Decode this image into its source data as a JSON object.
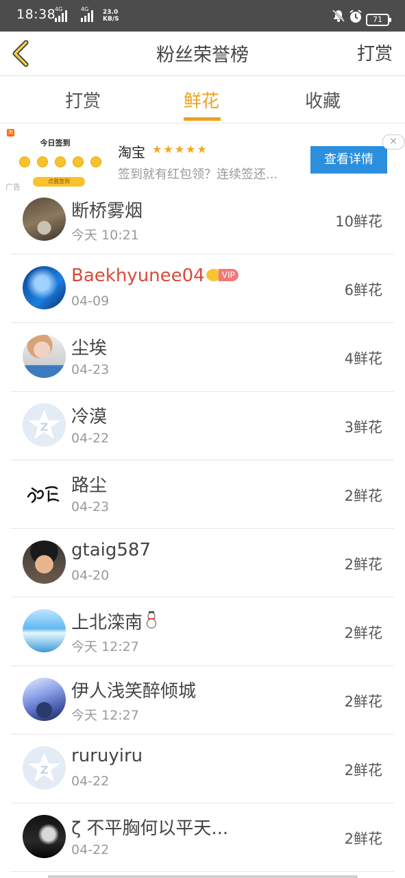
{
  "status_bar": {
    "time": "18:38",
    "signal_tag_1": "4G",
    "signal_tag_2": "4G",
    "net_speed_value": "23.0",
    "net_speed_unit": "KB/S",
    "battery": "71"
  },
  "nav": {
    "title": "粉丝荣誉榜",
    "action_label": "打赏"
  },
  "tabs": [
    {
      "label": "打赏",
      "active": false
    },
    {
      "label": "鲜花",
      "active": true
    },
    {
      "label": "收藏",
      "active": false
    }
  ],
  "ad": {
    "thumb_badge": "淘",
    "thumb_title": "今日签到",
    "thumb_button": "点我签到",
    "label": "广告",
    "brand": "淘宝",
    "rating": "★★★★★",
    "description": "签到就有红包领？连续签还...",
    "cta": "查看详情",
    "close": "×"
  },
  "fans": [
    {
      "name": "断桥雾烟",
      "time": "今天 10:21",
      "count": "10鲜花"
    },
    {
      "name": "Baekhyunee04",
      "time": "04-09",
      "count": "6鲜花",
      "vip": "VIP"
    },
    {
      "name": "尘埃",
      "time": "04-23",
      "count": "4鲜花"
    },
    {
      "name": "冷漠",
      "time": "04-22",
      "count": "3鲜花"
    },
    {
      "name": "路尘",
      "time": "04-23",
      "count": "2鲜花"
    },
    {
      "name": "gtaig587",
      "time": "04-20",
      "count": "2鲜花"
    },
    {
      "name": "上北滦南",
      "time": "今天 12:27",
      "count": "2鲜花"
    },
    {
      "name": "伊人浅笑醉倾城",
      "time": "今天 12:27",
      "count": "2鲜花"
    },
    {
      "name": "ruruyiru",
      "time": "04-22",
      "count": "2鲜花"
    },
    {
      "name": "ζ 不平胸何以平天...",
      "time": "04-22",
      "count": "2鲜花"
    }
  ],
  "colors": {
    "accent": "#f0a020",
    "vip_name": "#d94a38",
    "ad_button": "#2b8fde",
    "status_bar": "#4c4c4c"
  }
}
